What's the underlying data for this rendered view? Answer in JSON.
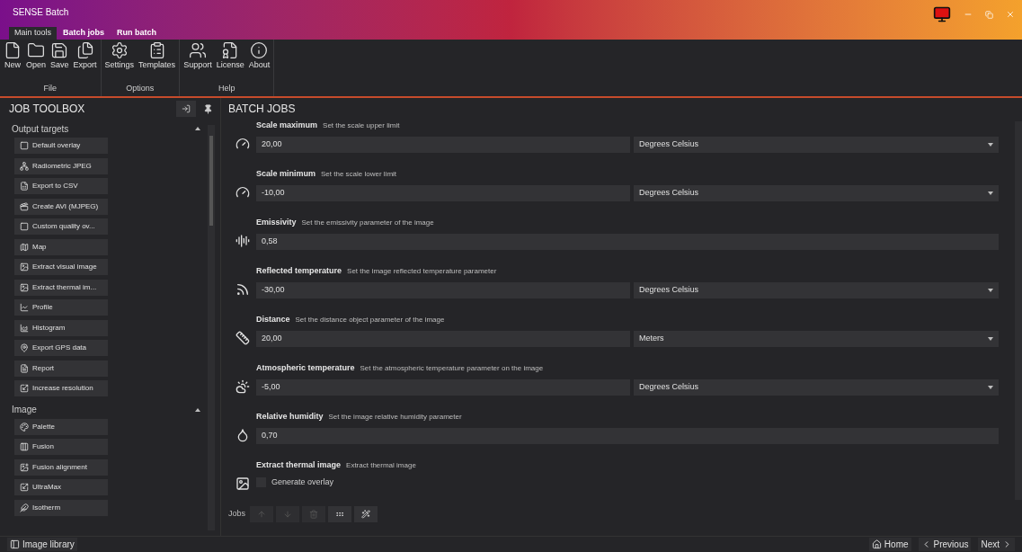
{
  "window": {
    "title": "SENSE Batch"
  },
  "tabs": [
    {
      "label": "Main tools",
      "selected": true
    },
    {
      "label": "Batch jobs",
      "selected": false
    },
    {
      "label": "Run batch",
      "selected": false
    }
  ],
  "ribbon": [
    {
      "label": "File",
      "buttons": [
        "New",
        "Open",
        "Save",
        "Export"
      ]
    },
    {
      "label": "Options",
      "buttons": [
        "Settings",
        "Templates"
      ]
    },
    {
      "label": "Help",
      "buttons": [
        "Support",
        "License",
        "About"
      ]
    }
  ],
  "toolbox": {
    "title": "JOB TOOLBOX",
    "sections": [
      {
        "title": "Output targets",
        "expanded": true,
        "items": [
          "Default overlay",
          "Radiometric JPEG",
          "Export to CSV",
          "Create AVI (MJPEG)",
          "Custom quality ov...",
          "Map",
          "Extract visual image",
          "Extract thermal im...",
          "Profile",
          "Histogram",
          "Export GPS data",
          "Report",
          "Increase resolution"
        ]
      },
      {
        "title": "Image",
        "expanded": true,
        "items": [
          "Palette",
          "Fusion",
          "Fusion alignment",
          "UltraMax",
          "Isotherm"
        ]
      }
    ]
  },
  "batch_jobs": {
    "title": "BATCH JOBS",
    "jobs": [
      {
        "kind": "field",
        "title": "Scale maximum",
        "description": "Set the scale upper limit",
        "value": "20,00",
        "unit": "Degrees Celsius"
      },
      {
        "kind": "field",
        "title": "Scale minimum",
        "description": "Set the scale lower limit",
        "value": "-10,00",
        "unit": "Degrees Celsius"
      },
      {
        "kind": "field",
        "title": "Emissivity",
        "description": "Set the emissivity parameter of the image",
        "value": "0,58"
      },
      {
        "kind": "field",
        "title": "Reflected temperature",
        "description": "Set the image reflected temperature parameter",
        "value": "-30,00",
        "unit": "Degrees Celsius"
      },
      {
        "kind": "field",
        "title": "Distance",
        "description": "Set the distance object parameter of the image",
        "value": "20,00",
        "unit": "Meters"
      },
      {
        "kind": "field",
        "title": "Atmospheric temperature",
        "description": "Set the atmospheric temperature parameter on the image",
        "value": "-5,00",
        "unit": "Degrees Celsius"
      },
      {
        "kind": "field",
        "title": "Relative humidity",
        "description": "Set the image relative humidity parameter",
        "value": "0,70"
      },
      {
        "kind": "checkbox",
        "title": "Extract thermal image",
        "description": "Extract thermal image",
        "option": {
          "label": "Generate overlay",
          "checked": false
        }
      }
    ],
    "toolbar": {
      "label": "Jobs",
      "buttons": [
        {
          "disabled": true
        },
        {
          "disabled": true
        },
        {
          "disabled": true
        },
        {
          "disabled": false
        },
        {
          "disabled": false
        }
      ]
    }
  },
  "footer": {
    "library": "Image library",
    "nav": [
      "Home",
      "Previous",
      "Next"
    ]
  }
}
